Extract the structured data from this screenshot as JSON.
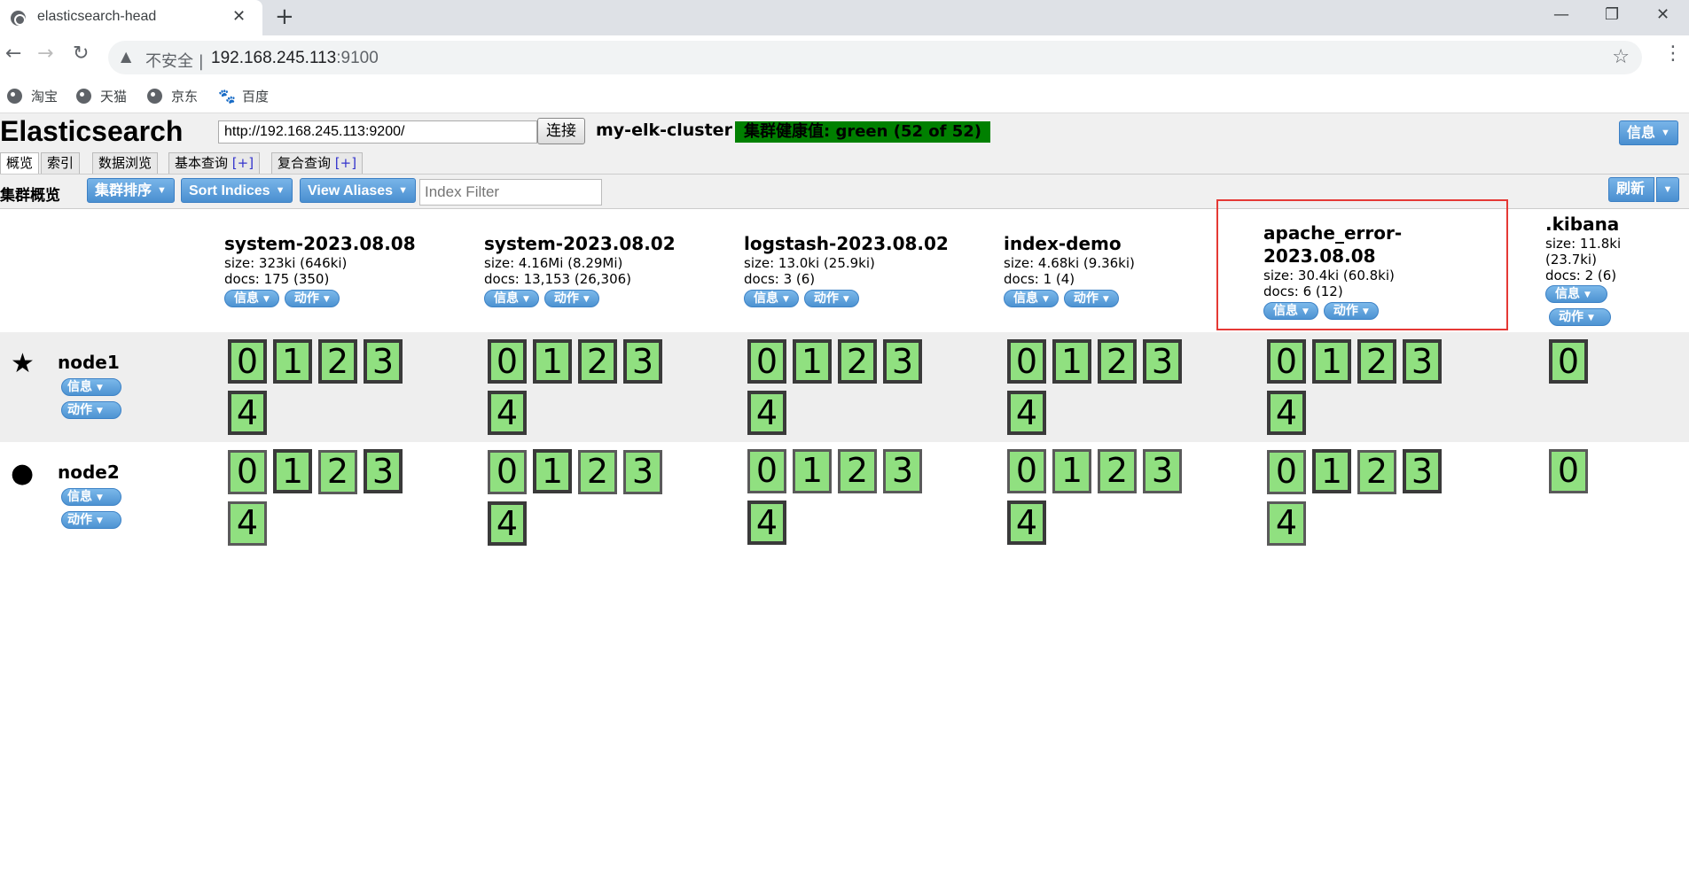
{
  "browser": {
    "tab_title": "elasticsearch-head",
    "tab_close": "✕",
    "new_tab": "+",
    "insecure_label": "不安全 |",
    "url_host": "192.168.245.113",
    "url_port": ":9100",
    "bookmarks": [
      {
        "label": "淘宝",
        "icon": "globe-icon"
      },
      {
        "label": "天猫",
        "icon": "globe-icon"
      },
      {
        "label": "京东",
        "icon": "globe-icon"
      },
      {
        "label": "百度",
        "icon": "baidu-paw-icon"
      }
    ]
  },
  "app": {
    "title": "Elasticsearch",
    "connect_url": "http://192.168.245.113:9200/",
    "connect_button": "连接",
    "cluster_name": "my-elk-cluster",
    "health": "集群健康值: green (52 of 52)",
    "health_color": "#008000",
    "info_button": "信息",
    "tabs": [
      {
        "label": "概览",
        "plus": ""
      },
      {
        "label": "索引",
        "plus": ""
      },
      {
        "label": "数据浏览",
        "plus": ""
      },
      {
        "label": "基本查询",
        "plus": "[+]"
      },
      {
        "label": "复合查询",
        "plus": "[+]"
      }
    ],
    "toolbar": {
      "title": "集群概览",
      "sort_cluster": "集群排序",
      "sort_indices": "Sort Indices",
      "view_aliases": "View Aliases",
      "index_filter_placeholder": "Index Filter",
      "refresh": "刷新"
    },
    "pill_info": "信息",
    "pill_action": "动作",
    "indices": [
      {
        "name": "system-2023.08.08",
        "size": "size: 323ki (646ki)",
        "docs": "docs: 175 (350)",
        "shards": [
          "0",
          "1",
          "2",
          "3",
          "4"
        ]
      },
      {
        "name": "system-2023.08.02",
        "size": "size: 4.16Mi (8.29Mi)",
        "docs": "docs: 13,153 (26,306)",
        "shards": [
          "0",
          "1",
          "2",
          "3",
          "4"
        ]
      },
      {
        "name": "logstash-2023.08.02",
        "size": "size: 13.0ki (25.9ki)",
        "docs": "docs: 3 (6)",
        "shards": [
          "0",
          "1",
          "2",
          "3",
          "4"
        ]
      },
      {
        "name": "index-demo",
        "size": "size: 4.68ki (9.36ki)",
        "docs": "docs: 1 (4)",
        "shards": [
          "0",
          "1",
          "2",
          "3",
          "4"
        ]
      },
      {
        "name": "apache_error-2023.08.08",
        "name_line1": "apache_error-",
        "name_line2": "2023.08.08",
        "size": "size: 30.4ki (60.8ki)",
        "docs": "docs: 6 (12)",
        "shards": [
          "0",
          "1",
          "2",
          "3",
          "4"
        ]
      },
      {
        "name": ".kibana",
        "size_line1": "size: 11.8ki",
        "size_line2": "(23.7ki)",
        "docs": "docs: 2 (6)",
        "shards": [
          "0"
        ]
      }
    ],
    "nodes": [
      {
        "name": "node1",
        "icon": "star-icon",
        "symbol": "★"
      },
      {
        "name": "node2",
        "icon": "circle-icon",
        "symbol": "●"
      }
    ]
  }
}
